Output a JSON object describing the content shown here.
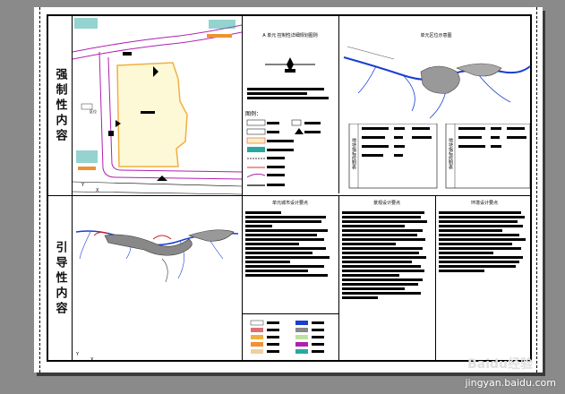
{
  "side_labels": {
    "upper": "强制性内容",
    "lower": "引导性内容"
  },
  "panel_titles": {
    "top_middle": "A 单元 控制性详细规划图则",
    "top_right": "单元区位示意图",
    "bottom_a": "单元城市设计要点",
    "bottom_b": "景观设计要点",
    "bottom_c": "环境设计要点"
  },
  "legend_title": "图例：",
  "map_label": "区位",
  "table_side_left": "地块指标控制表",
  "table_side_right": "地块指标控制表",
  "watermark": {
    "brand": "Baidu经验",
    "url": "jingyan.baidu.com"
  },
  "colors": {
    "background": "#8a8a8a",
    "sheet": "#ffffff",
    "site_fill": "#fdf8d6",
    "site_border": "#f0b040",
    "road": "#b020b0",
    "river": "#1a3fd0",
    "green": "#2aa8a0"
  }
}
